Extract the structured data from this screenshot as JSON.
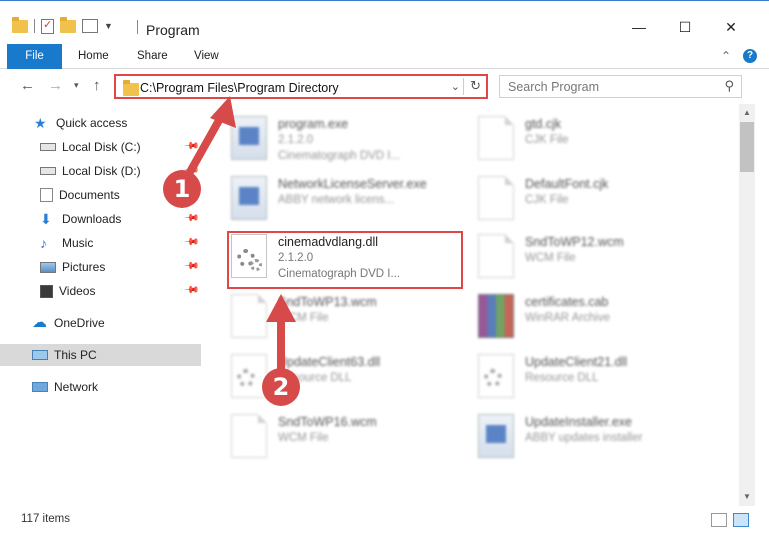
{
  "window": {
    "title": "Program",
    "controls": {
      "minimize": "—",
      "maximize": "☐",
      "close": "✕"
    }
  },
  "ribbon": {
    "tabs": [
      "File",
      "Home",
      "Share",
      "View"
    ],
    "help": "?"
  },
  "navigation": {
    "address": "C:\\Program Files\\Program Directory",
    "search_placeholder": "Search Program"
  },
  "sidebar": {
    "items": [
      {
        "label": "Quick access",
        "icon": "star-icon"
      },
      {
        "label": "Local Disk (C:)",
        "icon": "drive-icon",
        "pinned": true
      },
      {
        "label": "Local Disk (D:)",
        "icon": "drive-icon",
        "pinned": true
      },
      {
        "label": "Documents",
        "icon": "documents-icon",
        "pinned": true
      },
      {
        "label": "Downloads",
        "icon": "download-icon",
        "pinned": true
      },
      {
        "label": "Music",
        "icon": "music-icon",
        "pinned": true
      },
      {
        "label": "Pictures",
        "icon": "pictures-icon",
        "pinned": true
      },
      {
        "label": "Videos",
        "icon": "videos-icon",
        "pinned": true
      },
      {
        "label": "OneDrive",
        "icon": "cloud-icon"
      },
      {
        "label": "This PC",
        "icon": "computer-icon",
        "selected": true
      },
      {
        "label": "Network",
        "icon": "network-icon"
      }
    ]
  },
  "files": [
    {
      "name": "program.exe",
      "line1": "2.1.2.0",
      "line2": "Cinematograph DVD I...",
      "icon": "application-icon"
    },
    {
      "name": "gtd.cjk",
      "line1": "CJK File",
      "line2": "",
      "icon": "document-icon"
    },
    {
      "name": "NetworkLicenseServer.exe",
      "line1": "ABBY network licens...",
      "line2": "",
      "icon": "application-icon"
    },
    {
      "name": "DefaultFont.cjk",
      "line1": "CJK File",
      "line2": "",
      "icon": "document-icon"
    },
    {
      "name": "cinemadvdlang.dll",
      "line1": "2.1.2.0",
      "line2": "Cinematograph DVD I...",
      "icon": "dll-gear-icon"
    },
    {
      "name": "SndToWP12.wcm",
      "line1": "WCM File",
      "line2": "",
      "icon": "document-icon"
    },
    {
      "name": "SndToWP13.wcm",
      "line1": "WCM File",
      "line2": "",
      "icon": "document-icon"
    },
    {
      "name": "certificates.cab",
      "line1": "WinRAR Archive",
      "line2": "",
      "icon": "winrar-archive-icon"
    },
    {
      "name": "UpdateClient63.dll",
      "line1": "Resource DLL",
      "line2": "",
      "icon": "dll-gear-icon"
    },
    {
      "name": "UpdateClient21.dll",
      "line1": "Resource DLL",
      "line2": "",
      "icon": "dll-gear-icon"
    },
    {
      "name": "SndToWP16.wcm",
      "line1": "WCM File",
      "line2": "",
      "icon": "document-icon"
    },
    {
      "name": "UpdateInstaller.exe",
      "line1": "ABBY updates installer",
      "line2": "",
      "icon": "application-icon"
    }
  ],
  "status": {
    "item_count": "117 items"
  },
  "annotations": {
    "step1": "1",
    "step2": "2",
    "accent_color": "#d64a4a"
  }
}
